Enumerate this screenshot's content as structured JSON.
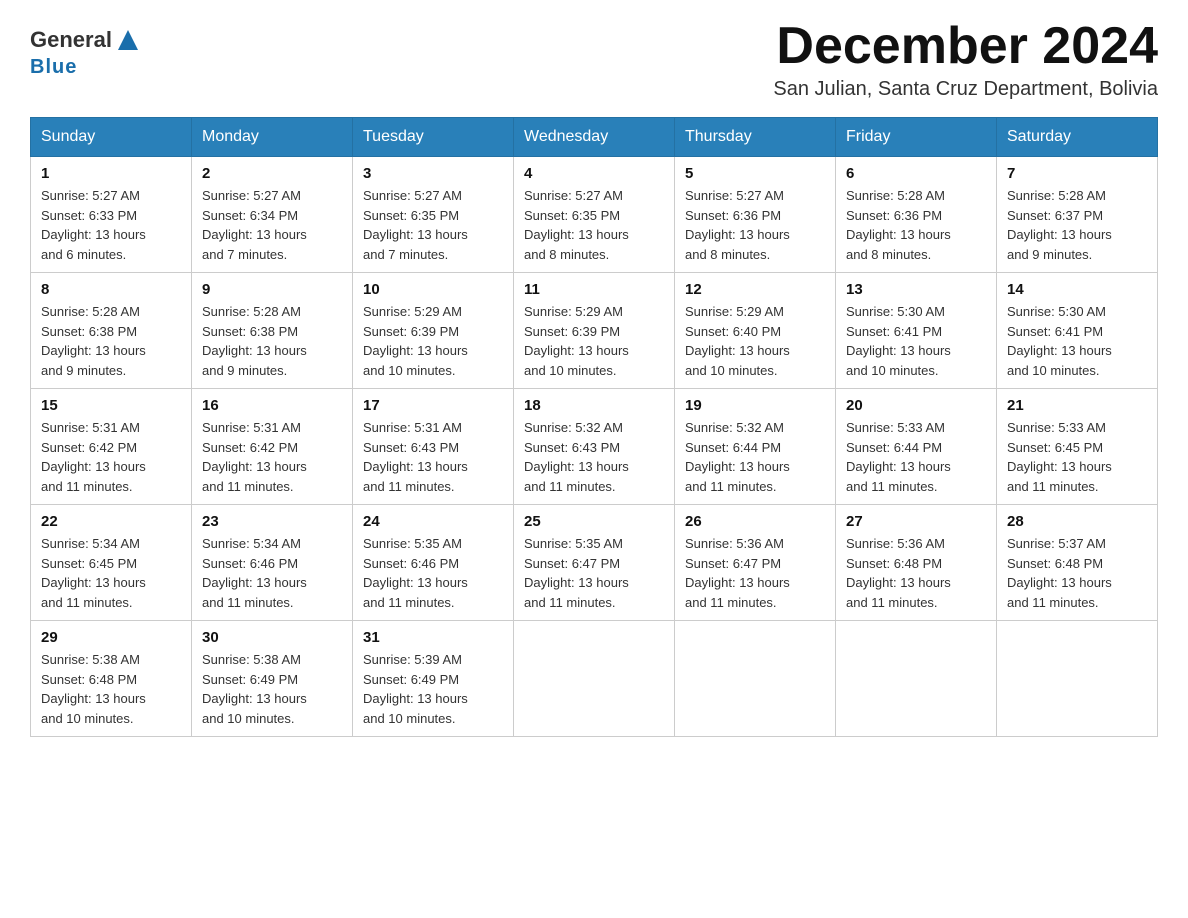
{
  "header": {
    "logo_general": "General",
    "logo_blue": "Blue",
    "month_title": "December 2024",
    "location": "San Julian, Santa Cruz Department, Bolivia"
  },
  "weekdays": [
    "Sunday",
    "Monday",
    "Tuesday",
    "Wednesday",
    "Thursday",
    "Friday",
    "Saturday"
  ],
  "weeks": [
    [
      {
        "day": "1",
        "sunrise": "5:27 AM",
        "sunset": "6:33 PM",
        "daylight": "13 hours and 6 minutes."
      },
      {
        "day": "2",
        "sunrise": "5:27 AM",
        "sunset": "6:34 PM",
        "daylight": "13 hours and 7 minutes."
      },
      {
        "day": "3",
        "sunrise": "5:27 AM",
        "sunset": "6:35 PM",
        "daylight": "13 hours and 7 minutes."
      },
      {
        "day": "4",
        "sunrise": "5:27 AM",
        "sunset": "6:35 PM",
        "daylight": "13 hours and 8 minutes."
      },
      {
        "day": "5",
        "sunrise": "5:27 AM",
        "sunset": "6:36 PM",
        "daylight": "13 hours and 8 minutes."
      },
      {
        "day": "6",
        "sunrise": "5:28 AM",
        "sunset": "6:36 PM",
        "daylight": "13 hours and 8 minutes."
      },
      {
        "day": "7",
        "sunrise": "5:28 AM",
        "sunset": "6:37 PM",
        "daylight": "13 hours and 9 minutes."
      }
    ],
    [
      {
        "day": "8",
        "sunrise": "5:28 AM",
        "sunset": "6:38 PM",
        "daylight": "13 hours and 9 minutes."
      },
      {
        "day": "9",
        "sunrise": "5:28 AM",
        "sunset": "6:38 PM",
        "daylight": "13 hours and 9 minutes."
      },
      {
        "day": "10",
        "sunrise": "5:29 AM",
        "sunset": "6:39 PM",
        "daylight": "13 hours and 10 minutes."
      },
      {
        "day": "11",
        "sunrise": "5:29 AM",
        "sunset": "6:39 PM",
        "daylight": "13 hours and 10 minutes."
      },
      {
        "day": "12",
        "sunrise": "5:29 AM",
        "sunset": "6:40 PM",
        "daylight": "13 hours and 10 minutes."
      },
      {
        "day": "13",
        "sunrise": "5:30 AM",
        "sunset": "6:41 PM",
        "daylight": "13 hours and 10 minutes."
      },
      {
        "day": "14",
        "sunrise": "5:30 AM",
        "sunset": "6:41 PM",
        "daylight": "13 hours and 10 minutes."
      }
    ],
    [
      {
        "day": "15",
        "sunrise": "5:31 AM",
        "sunset": "6:42 PM",
        "daylight": "13 hours and 11 minutes."
      },
      {
        "day": "16",
        "sunrise": "5:31 AM",
        "sunset": "6:42 PM",
        "daylight": "13 hours and 11 minutes."
      },
      {
        "day": "17",
        "sunrise": "5:31 AM",
        "sunset": "6:43 PM",
        "daylight": "13 hours and 11 minutes."
      },
      {
        "day": "18",
        "sunrise": "5:32 AM",
        "sunset": "6:43 PM",
        "daylight": "13 hours and 11 minutes."
      },
      {
        "day": "19",
        "sunrise": "5:32 AM",
        "sunset": "6:44 PM",
        "daylight": "13 hours and 11 minutes."
      },
      {
        "day": "20",
        "sunrise": "5:33 AM",
        "sunset": "6:44 PM",
        "daylight": "13 hours and 11 minutes."
      },
      {
        "day": "21",
        "sunrise": "5:33 AM",
        "sunset": "6:45 PM",
        "daylight": "13 hours and 11 minutes."
      }
    ],
    [
      {
        "day": "22",
        "sunrise": "5:34 AM",
        "sunset": "6:45 PM",
        "daylight": "13 hours and 11 minutes."
      },
      {
        "day": "23",
        "sunrise": "5:34 AM",
        "sunset": "6:46 PM",
        "daylight": "13 hours and 11 minutes."
      },
      {
        "day": "24",
        "sunrise": "5:35 AM",
        "sunset": "6:46 PM",
        "daylight": "13 hours and 11 minutes."
      },
      {
        "day": "25",
        "sunrise": "5:35 AM",
        "sunset": "6:47 PM",
        "daylight": "13 hours and 11 minutes."
      },
      {
        "day": "26",
        "sunrise": "5:36 AM",
        "sunset": "6:47 PM",
        "daylight": "13 hours and 11 minutes."
      },
      {
        "day": "27",
        "sunrise": "5:36 AM",
        "sunset": "6:48 PM",
        "daylight": "13 hours and 11 minutes."
      },
      {
        "day": "28",
        "sunrise": "5:37 AM",
        "sunset": "6:48 PM",
        "daylight": "13 hours and 11 minutes."
      }
    ],
    [
      {
        "day": "29",
        "sunrise": "5:38 AM",
        "sunset": "6:48 PM",
        "daylight": "13 hours and 10 minutes."
      },
      {
        "day": "30",
        "sunrise": "5:38 AM",
        "sunset": "6:49 PM",
        "daylight": "13 hours and 10 minutes."
      },
      {
        "day": "31",
        "sunrise": "5:39 AM",
        "sunset": "6:49 PM",
        "daylight": "13 hours and 10 minutes."
      },
      null,
      null,
      null,
      null
    ]
  ],
  "labels": {
    "sunrise": "Sunrise:",
    "sunset": "Sunset:",
    "daylight": "Daylight:"
  }
}
